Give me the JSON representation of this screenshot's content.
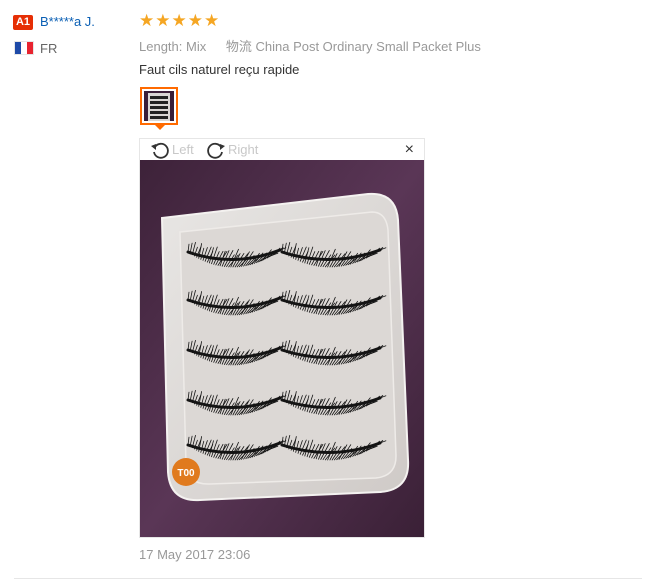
{
  "user": {
    "level_badge": "A1",
    "name": "B*****a J.",
    "country": "FR",
    "flag_colors": [
      "#1e4aa8",
      "#ffffff",
      "#e8232f"
    ]
  },
  "rating": {
    "stars": 5,
    "star_glyph": "★",
    "color": "#f5a623"
  },
  "attributes": {
    "length_label": "Length:",
    "length_value": "Mix",
    "shipping_label": "物流",
    "shipping_value": "China Post Ordinary Small Packet Plus"
  },
  "comment": "Faut cils naturel reçu rapide",
  "viewer": {
    "rotate_left_label": "Left",
    "rotate_right_label": "Right",
    "close_glyph": "×",
    "photo_stamp": "T00"
  },
  "date": "17 May 2017 23:06",
  "colors": {
    "accent": "#ff6a00",
    "link": "#0a5fb4",
    "badge": "#e62e04"
  }
}
